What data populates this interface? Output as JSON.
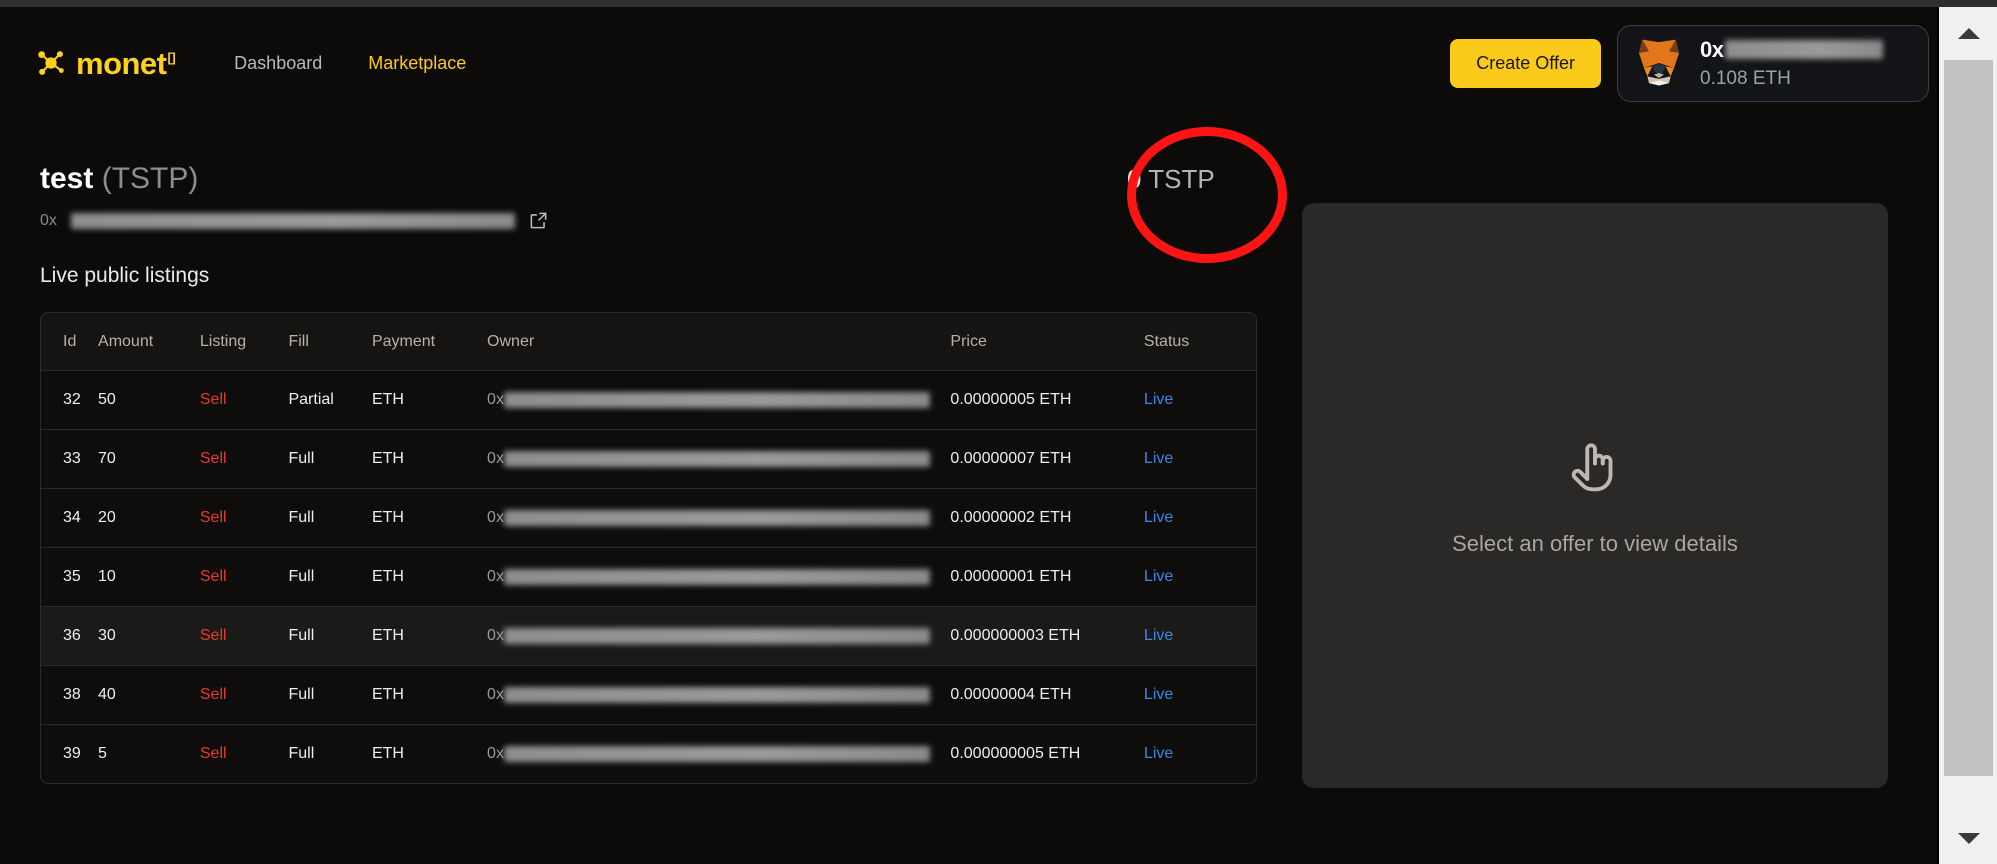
{
  "brand": {
    "name": "monet",
    "superscript": "[]",
    "logo_icon": "molecule-network-icon",
    "accent_color": "#ffd21a"
  },
  "nav": {
    "links": [
      {
        "label": "Dashboard",
        "active": false
      },
      {
        "label": "Marketplace",
        "active": true
      }
    ]
  },
  "header_actions": {
    "create_offer_label": "Create Offer",
    "create_offer_color": "#fbcb1c"
  },
  "wallet": {
    "provider_icon": "metamask-fox-icon",
    "address_prefix": "0x",
    "address_redacted": true,
    "balance": "0.108 ETH"
  },
  "token": {
    "name": "test",
    "symbol": "(TSTP)",
    "address_prefix": "0x",
    "address_redacted": true,
    "explorer_icon": "external-link-icon"
  },
  "balance_badge": {
    "amount": "0",
    "symbol": "TSTP",
    "annotation": "red-circle-highlight",
    "annotation_color": "#ff1414"
  },
  "listings": {
    "section_title": "Live public listings",
    "columns": [
      "Id",
      "Amount",
      "Listing",
      "Fill",
      "Payment",
      "Owner",
      "Price",
      "Status"
    ],
    "rows": [
      {
        "id": "32",
        "amount": "50",
        "listing": "Sell",
        "fill": "Partial",
        "payment": "ETH",
        "owner_prefix": "0x",
        "price": "0.00000005 ETH",
        "status": "Live",
        "hovered": false
      },
      {
        "id": "33",
        "amount": "70",
        "listing": "Sell",
        "fill": "Full",
        "payment": "ETH",
        "owner_prefix": "0x",
        "price": "0.00000007 ETH",
        "status": "Live",
        "hovered": false
      },
      {
        "id": "34",
        "amount": "20",
        "listing": "Sell",
        "fill": "Full",
        "payment": "ETH",
        "owner_prefix": "0x",
        "price": "0.00000002 ETH",
        "status": "Live",
        "hovered": false
      },
      {
        "id": "35",
        "amount": "10",
        "listing": "Sell",
        "fill": "Full",
        "payment": "ETH",
        "owner_prefix": "0x",
        "price": "0.00000001 ETH",
        "status": "Live",
        "hovered": false
      },
      {
        "id": "36",
        "amount": "30",
        "listing": "Sell",
        "fill": "Full",
        "payment": "ETH",
        "owner_prefix": "0x",
        "price": "0.000000003 ETH",
        "status": "Live",
        "hovered": true
      },
      {
        "id": "38",
        "amount": "40",
        "listing": "Sell",
        "fill": "Full",
        "payment": "ETH",
        "owner_prefix": "0x",
        "price": "0.00000004 ETH",
        "status": "Live",
        "hovered": false
      },
      {
        "id": "39",
        "amount": "5",
        "listing": "Sell",
        "fill": "Full",
        "payment": "ETH",
        "owner_prefix": "0x",
        "price": "0.000000005 ETH",
        "status": "Live",
        "hovered": false
      }
    ],
    "sell_color": "#e8392c",
    "live_color": "#3b87e8"
  },
  "detail_panel": {
    "icon": "pointing-hand-icon",
    "message": "Select an offer to view details"
  },
  "scrollbar": {
    "up_icon": "caret-up-icon",
    "down_icon": "caret-down-icon"
  }
}
